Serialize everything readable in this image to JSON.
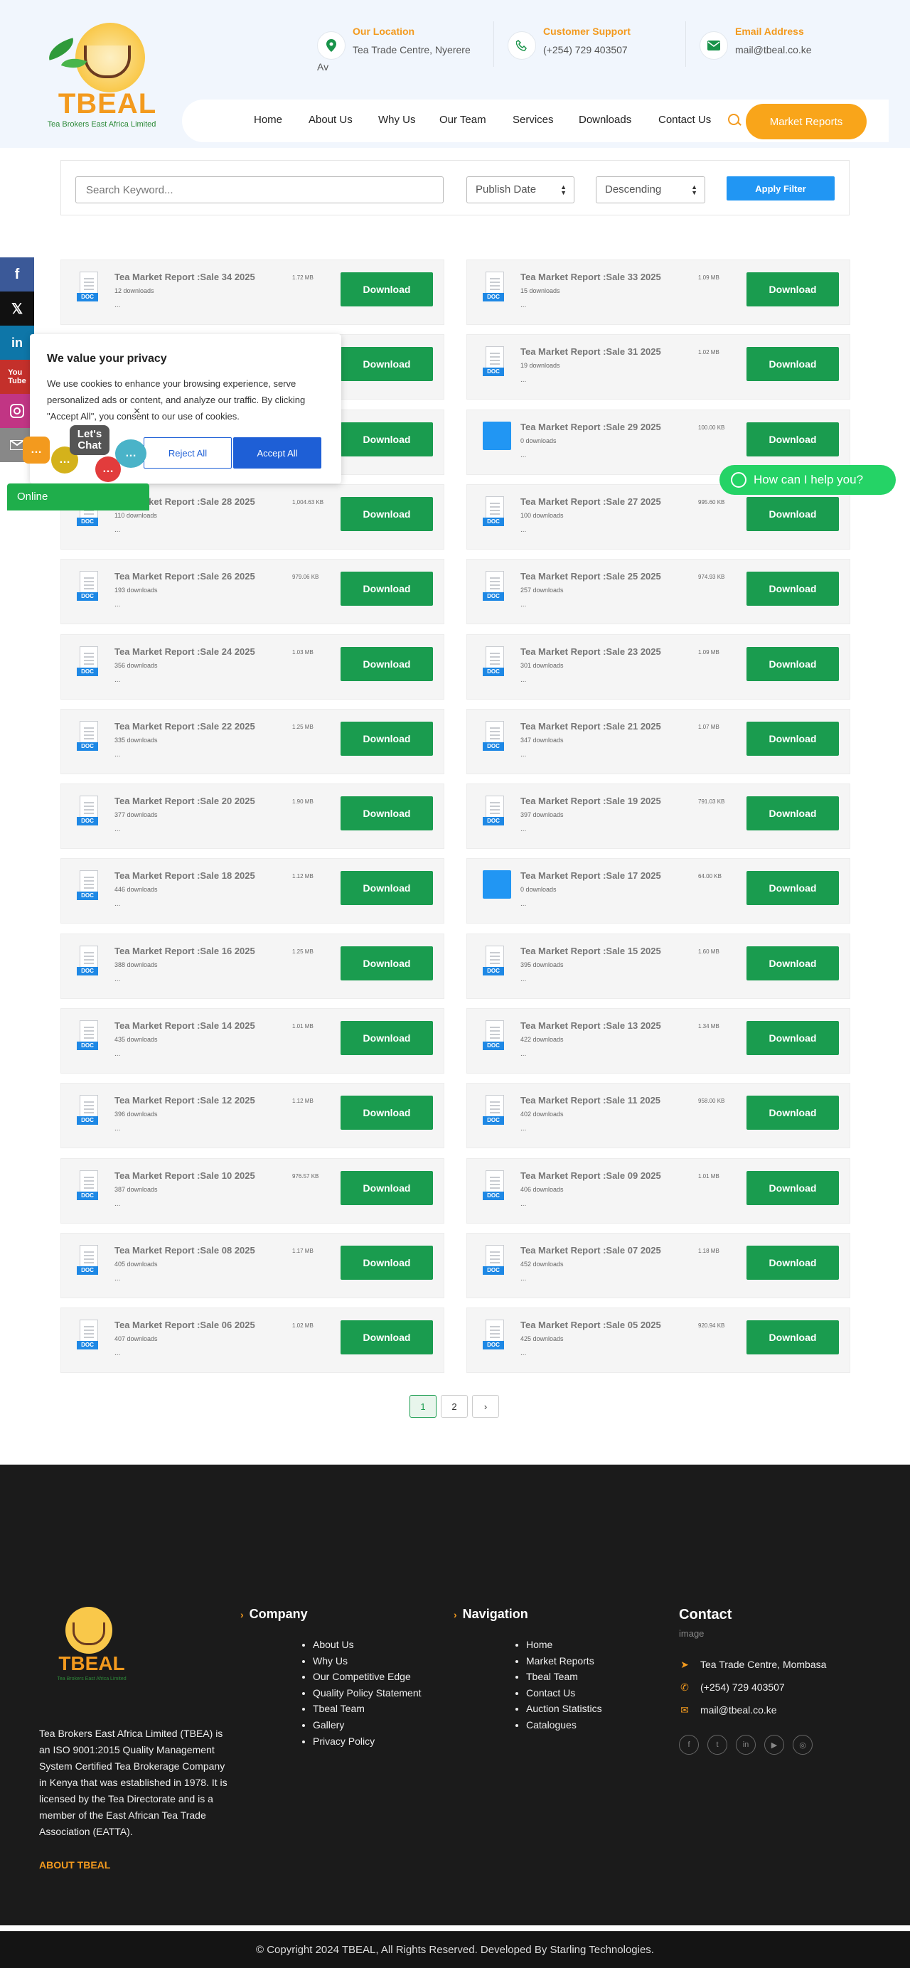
{
  "header": {
    "logo_text": "TBEAL",
    "logo_sub": "Tea Brokers East Africa Limited",
    "location": {
      "title": "Our Location",
      "value": "Tea Trade Centre, Nyerere Av"
    },
    "support": {
      "title": "Customer Support",
      "value": "(+254) 729 403507"
    },
    "email": {
      "title": "Email Address",
      "value": "mail@tbeal.co.ke"
    },
    "nav": [
      "Home",
      "About Us",
      "Why Us",
      "Our Team",
      "Services",
      "Downloads",
      "Contact Us"
    ],
    "cta": "Market Reports"
  },
  "filter": {
    "search_placeholder": "Search Keyword...",
    "sort_field": "Publish Date",
    "sort_order": "Descending",
    "apply_label": "Apply Filter"
  },
  "reports": [
    {
      "title": "Tea Market Report :Sale 34 2025",
      "downloads": "12 downloads",
      "size": "1.72 MB",
      "icon": "doc"
    },
    {
      "title": "Tea Market Report :Sale 33 2025",
      "downloads": "15 downloads",
      "size": "1.09 MB",
      "icon": "doc"
    },
    {
      "title": "",
      "downloads": "",
      "size": "",
      "icon": "doc"
    },
    {
      "title": "Tea Market Report :Sale 31 2025",
      "downloads": "19 downloads",
      "size": "1.02 MB",
      "icon": "doc"
    },
    {
      "title": "",
      "downloads": "",
      "size": "",
      "icon": "doc"
    },
    {
      "title": "Tea Market Report :Sale 29 2025",
      "downloads": "0 downloads",
      "size": "100.00 KB",
      "icon": "image"
    },
    {
      "title": "Tea Market Report :Sale 28 2025",
      "downloads": "110 downloads",
      "size": "1,004.63 KB",
      "icon": "doc"
    },
    {
      "title": "Tea Market Report :Sale 27 2025",
      "downloads": "100 downloads",
      "size": "995.60 KB",
      "icon": "doc"
    },
    {
      "title": "Tea Market Report :Sale 26 2025",
      "downloads": "193 downloads",
      "size": "979.06 KB",
      "icon": "doc"
    },
    {
      "title": "Tea Market Report :Sale 25 2025",
      "downloads": "257 downloads",
      "size": "974.93 KB",
      "icon": "doc"
    },
    {
      "title": "Tea Market Report :Sale 24 2025",
      "downloads": "356 downloads",
      "size": "1.03 MB",
      "icon": "doc"
    },
    {
      "title": "Tea Market Report :Sale 23 2025",
      "downloads": "301 downloads",
      "size": "1.09 MB",
      "icon": "doc"
    },
    {
      "title": "Tea Market Report :Sale 22 2025",
      "downloads": "335 downloads",
      "size": "1.25 MB",
      "icon": "doc"
    },
    {
      "title": "Tea Market Report :Sale 21 2025",
      "downloads": "347 downloads",
      "size": "1.07 MB",
      "icon": "doc"
    },
    {
      "title": "Tea Market Report :Sale 20 2025",
      "downloads": "377 downloads",
      "size": "1.90 MB",
      "icon": "doc"
    },
    {
      "title": "Tea Market Report :Sale 19 2025",
      "downloads": "397 downloads",
      "size": "791.03 KB",
      "icon": "doc"
    },
    {
      "title": "Tea Market Report :Sale 18 2025",
      "downloads": "446 downloads",
      "size": "1.12 MB",
      "icon": "doc"
    },
    {
      "title": "Tea Market Report :Sale 17 2025",
      "downloads": "0 downloads",
      "size": "64.00 KB",
      "icon": "image"
    },
    {
      "title": "Tea Market Report :Sale 16 2025",
      "downloads": "388 downloads",
      "size": "1.25 MB",
      "icon": "doc"
    },
    {
      "title": "Tea Market Report :Sale 15 2025",
      "downloads": "395 downloads",
      "size": "1.60 MB",
      "icon": "doc"
    },
    {
      "title": "Tea Market Report :Sale 14 2025",
      "downloads": "435 downloads",
      "size": "1.01 MB",
      "icon": "doc"
    },
    {
      "title": "Tea Market Report :Sale 13 2025",
      "downloads": "422 downloads",
      "size": "1.34 MB",
      "icon": "doc"
    },
    {
      "title": "Tea Market Report :Sale 12 2025",
      "downloads": "396 downloads",
      "size": "1.12 MB",
      "icon": "doc"
    },
    {
      "title": "Tea Market Report :Sale 11 2025",
      "downloads": "402 downloads",
      "size": "958.00 KB",
      "icon": "doc"
    },
    {
      "title": "Tea Market Report :Sale 10 2025",
      "downloads": "387 downloads",
      "size": "976.57 KB",
      "icon": "doc"
    },
    {
      "title": "Tea Market Report :Sale 09 2025",
      "downloads": "406 downloads",
      "size": "1.01 MB",
      "icon": "doc"
    },
    {
      "title": "Tea Market Report :Sale 08 2025",
      "downloads": "405 downloads",
      "size": "1.17 MB",
      "icon": "doc"
    },
    {
      "title": "Tea Market Report :Sale 07 2025",
      "downloads": "452 downloads",
      "size": "1.18 MB",
      "icon": "doc"
    },
    {
      "title": "Tea Market Report :Sale 06 2025",
      "downloads": "407 downloads",
      "size": "1.02 MB",
      "icon": "doc"
    },
    {
      "title": "Tea Market Report :Sale 05 2025",
      "downloads": "425 downloads",
      "size": "920.94 KB",
      "icon": "doc"
    }
  ],
  "card_labels": {
    "download": "Download",
    "doc_tag": "DOC",
    "dots": "..."
  },
  "pagination": {
    "pages": [
      "1",
      "2"
    ],
    "next": "›"
  },
  "cookie": {
    "title": "We value your privacy",
    "text": "We use cookies to enhance your browsing experience, serve personalized ads or content, and analyze our traffic. By clicking \"Accept All\", you consent to our use of cookies.",
    "reject": "Reject All",
    "accept": "Accept All",
    "close": "×"
  },
  "chat": {
    "lets_chat": "Let's Chat",
    "online": "Online",
    "whatsapp": "How can I help you?"
  },
  "footer": {
    "description": "Tea Brokers East Africa Limited (TBEA) is an ISO 9001:2015 Quality Management System Certified Tea Brokerage Company in Kenya that was established in 1978. It is licensed by the Tea Directorate and is a member of the East African Tea Trade Association (EATTA).",
    "about_link": "ABOUT TBEAL",
    "company_title": "Company",
    "company_links": [
      "About Us",
      "Why Us",
      "Our Competitive Edge",
      "Quality Policy Statement",
      "Tbeal Team",
      "Gallery",
      "Privacy Policy"
    ],
    "nav_title": "Navigation",
    "nav_links": [
      "Home",
      "Market Reports",
      "Tbeal Team",
      "Contact Us",
      "Auction Statistics",
      "Catalogues"
    ],
    "contact_title": "Contact",
    "image_alt": "image",
    "contact_address": "Tea Trade Centre, Mombasa",
    "contact_phone": "(+254) 729 403507",
    "contact_email": "mail@tbeal.co.ke",
    "copyright": "© Copyright 2024 TBEAL, All Rights Reserved. Developed By Starling Technologies."
  },
  "colors": {
    "brand_green": "#1a9c4f",
    "brand_orange": "#f39a1e",
    "apply_blue": "#2196f3"
  }
}
